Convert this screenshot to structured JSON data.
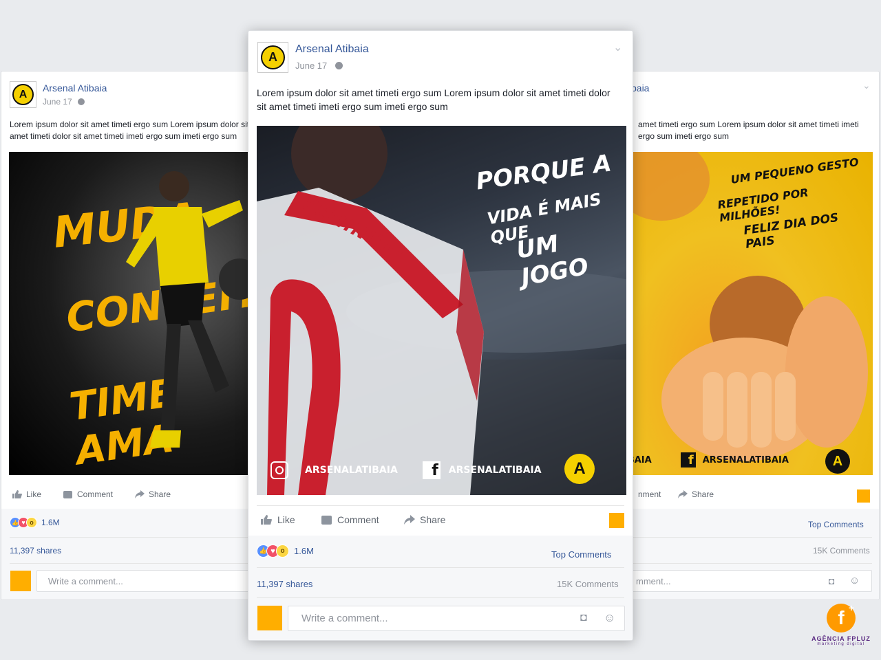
{
  "posts": {
    "left": {
      "page_name": "Arsenal Atibaia",
      "date": "June 17",
      "text": "Lorem ipsum dolor sit amet timeti ergo sum Lorem ipsum dolor sit amet timeti dolor sit amet timeti imeti ergo sum imeti ergo sum",
      "image_caption_1": "MUDA",
      "image_caption_2": "CONCEITO",
      "image_caption_3": "TIME AMA",
      "actions": {
        "like": "Like",
        "comment": "Comment",
        "share": "Share"
      },
      "reactions_count": "1.6M",
      "shares": "11,397 shares",
      "comment_placeholder": "Write a comment..."
    },
    "center": {
      "page_name": "Arsenal Atibaia",
      "date": "June 17",
      "text": "Lorem ipsum dolor sit amet timeti ergo sum Lorem ipsum dolor sit amet timeti dolor sit amet timeti imeti ergo sum imeti ergo sum",
      "image_headline_1": "PORQUE A",
      "image_headline_2": "VIDA É MAIS QUE",
      "image_headline_3": "UM JOGO",
      "image_jersey": "FEMININO",
      "instagram_handle": "ARSENALATIBAIA",
      "facebook_handle": "ARSENALATIBAIA",
      "actions": {
        "like": "Like",
        "comment": "Comment",
        "share": "Share"
      },
      "reactions_count": "1.6M",
      "top_comments": "Top Comments",
      "shares": "11,397 shares",
      "comments_count": "15K Comments",
      "comment_placeholder": "Write a comment..."
    },
    "right": {
      "page_name_partial": "baia",
      "text": "amet timeti ergo sum Lorem ipsum dolor sit amet timeti imeti ergo sum imeti ergo sum",
      "image_text_1": "UM PEQUENO GESTO",
      "image_text_2": "REPETIDO POR MILHÕES!",
      "image_text_3": "FELIZ DIA DOS PAIS",
      "handle_partial": "IBAIA",
      "facebook_handle": "ARSENALATIBAIA",
      "actions": {
        "comment_partial": "nment",
        "share": "Share"
      },
      "top_comments": "Top Comments",
      "comments_count": "15K Comments",
      "comment_placeholder_partial": "mment..."
    }
  },
  "brand": {
    "name": "AGÊNCIA FPLUZ",
    "tagline": "marketing digital"
  },
  "colors": {
    "background": "#e9ebee",
    "link_blue": "#365899",
    "accent_orange": "#ffae00",
    "brand_yellow": "#f5d000"
  }
}
